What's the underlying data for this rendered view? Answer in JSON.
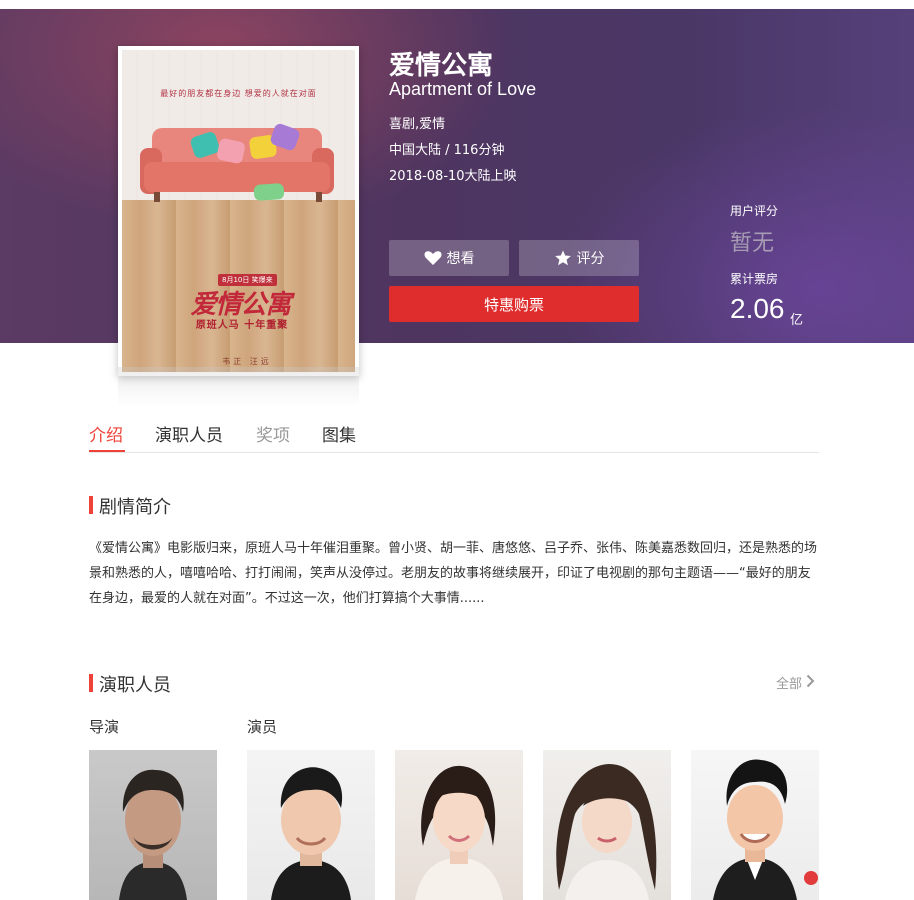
{
  "movie": {
    "title_cn": "爱情公寓",
    "title_en": "Apartment of Love",
    "genre": "喜剧,爱情",
    "region_duration": "中国大陆 / 116分钟",
    "release": "2018-08-10大陆上映"
  },
  "poster": {
    "tagline": "最好的朋友都在身边 想爱的人就在对面",
    "date_tag": "8月10日 笑爆来",
    "logo": "爱情公寓",
    "logo_sub": "原班人马 十年重聚",
    "director_line": "韦正 汪远"
  },
  "actions": {
    "want_label": "想看",
    "rate_label": "评分",
    "buy_label": "特惠购票"
  },
  "stats": {
    "score_label": "用户评分",
    "score_value": "暂无",
    "box_label": "累计票房",
    "box_value": "2.06",
    "box_unit": "亿"
  },
  "tabs": {
    "intro": "介绍",
    "cast": "演职人员",
    "awards": "奖项",
    "gallery": "图集"
  },
  "plot_section": {
    "heading": "剧情简介",
    "text": "《爱情公寓》电影版归来，原班人马十年催泪重聚。曾小贤、胡一菲、唐悠悠、吕子乔、张伟、陈美嘉悉数回归，还是熟悉的场景和熟悉的人，嘻嘻哈哈、打打闹闹，笑声从没停过。老朋友的故事将继续展开，印证了电视剧的那句主题语——“最好的朋友在身边，最爱的人就在对面”。不过这一次，他们打算搞个大事情......"
  },
  "cast_section": {
    "heading": "演职人员",
    "all_link": "全部",
    "director_label": "导演",
    "actor_label": "演员"
  },
  "colors": {
    "accent": "#ef4238",
    "buy_button": "#df2d2d",
    "banner": "#4e3560"
  }
}
